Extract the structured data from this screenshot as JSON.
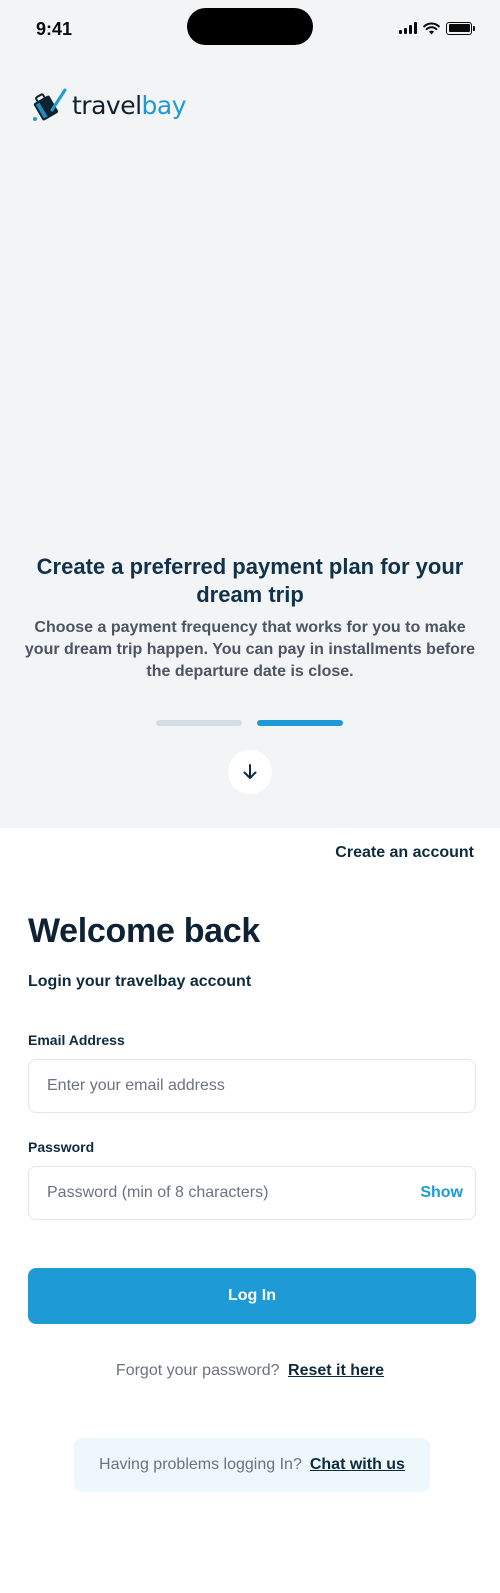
{
  "status_bar": {
    "time": "9:41"
  },
  "brand": {
    "name_part1": "travel",
    "name_part2": "bay",
    "colors": {
      "primary": "#1e9ad6",
      "dark": "#10222e"
    }
  },
  "onboarding": {
    "title": "Create a preferred payment plan for your dream trip",
    "description": "Choose a payment frequency that works for you to make your dream trip happen. You can pay in installments before the departure date is close.",
    "pager": {
      "total": 2,
      "active_index": 1
    },
    "scroll_icon": "arrow-down-icon"
  },
  "header": {
    "create_account_label": "Create an account"
  },
  "login": {
    "title": "Welcome back",
    "subtitle": "Login your travelbay account",
    "email": {
      "label": "Email Address",
      "placeholder": "Enter your email address",
      "value": ""
    },
    "password": {
      "label": "Password",
      "placeholder": "Password (min of 8 characters)",
      "value": "",
      "show_label": "Show"
    },
    "submit_label": "Log In",
    "forgot_text": "Forgot your password?",
    "reset_link": "Reset it here"
  },
  "help": {
    "text": "Having problems logging In?",
    "link": "Chat with us"
  }
}
